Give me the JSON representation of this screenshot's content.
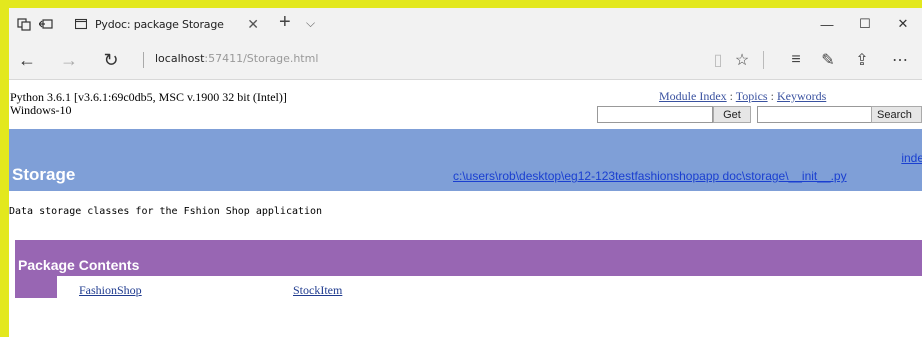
{
  "browser": {
    "tab": {
      "title": "Pydoc: package Storage",
      "close_label": "✕"
    },
    "new_tab_label": "+",
    "tab_list_label": "⌵",
    "window": {
      "minimize": "—",
      "maximize": "☐",
      "close": "✕"
    },
    "nav": {
      "back": "←",
      "forward": "→",
      "refresh": "↻"
    },
    "url": {
      "host": "localhost",
      "path": ":57411/Storage.html"
    },
    "tools": {
      "reading_view": "▯",
      "favorite": "☆",
      "hub": "≡",
      "notes": "✎",
      "share": "⇪",
      "more": "⋯"
    }
  },
  "page": {
    "sysinfo": {
      "python": "Python 3.6.1 [v3.6.1:69c0db5, MSC v.1900 32 bit (Intel)]",
      "os": "Windows-10"
    },
    "links": {
      "module_index": "Module Index",
      "topics": "Topics",
      "keywords": "Keywords",
      "sep": " : "
    },
    "get_button": "Get",
    "search_button": "Search",
    "module": {
      "title": "Storage",
      "index_link": "index",
      "file_link": "c:\\users\\rob\\desktop\\eg12-123testfashionshopapp doc\\storage\\__init__.py"
    },
    "docstring": "Data storage classes for the Fshion Shop application",
    "package_contents": {
      "title": "Package Contents",
      "items": [
        "FashionShop",
        "StockItem"
      ]
    }
  },
  "colors": {
    "border_yellow": "#e3e81e",
    "module_band": "#7f9fd7",
    "section_band": "#9866b3"
  }
}
